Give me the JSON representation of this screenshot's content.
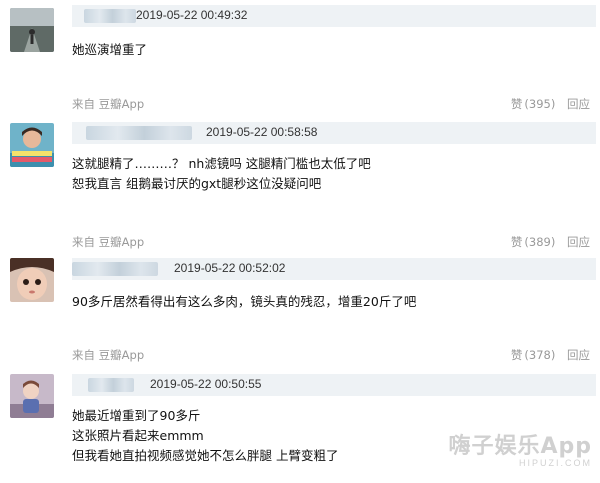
{
  "comments": [
    {
      "timestamp": "2019-05-22 00:49:32",
      "lines": [
        "她巡演增重了"
      ],
      "source": "来自 豆瓣App",
      "like_label": "赞",
      "likes": "(395)",
      "reply_label": "回应"
    },
    {
      "timestamp": "2019-05-22 00:58:58",
      "lines": [
        "这就腿精了………？ nh滤镜吗 这腿精门槛也太低了吧",
        "恕我直言 组鹅最讨厌的gxt腿秒这位没疑问吧"
      ],
      "source": "来自 豆瓣App",
      "like_label": "赞",
      "likes": "(389)",
      "reply_label": "回应"
    },
    {
      "timestamp": "2019-05-22 00:52:02",
      "lines": [
        "90多斤居然看得出有这么多肉，镜头真的残忍，增重20斤了吧"
      ],
      "source": "来自 豆瓣App",
      "like_label": "赞",
      "likes": "(378)",
      "reply_label": "回应"
    },
    {
      "timestamp": "2019-05-22 00:50:55",
      "lines": [
        "她最近增重到了90多斤",
        "这张照片看起来emmm",
        "但我看她直拍视频感觉她不怎么胖腿 上臂变粗了"
      ]
    }
  ],
  "watermark": {
    "title": "嗨子娱乐App",
    "url": "HIPUZI.COM"
  }
}
